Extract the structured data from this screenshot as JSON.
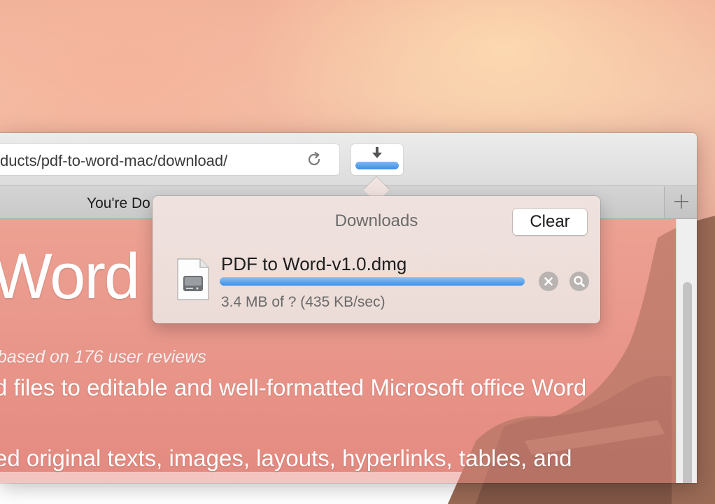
{
  "browser": {
    "address_bar": {
      "url": "ducts/pdf-to-word-mac/download/"
    },
    "reload_icon": "reload-icon",
    "downloads_icon": "download-arrow-icon",
    "tab": {
      "title": "You're Do"
    },
    "new_tab_icon": "plus-icon"
  },
  "page": {
    "headline": "Word",
    "rating": "based on 176 user reviews",
    "description": [
      "d files to editable and well-formatted Microsoft office Word",
      "ed original texts, images, layouts, hyperlinks, tables, and"
    ]
  },
  "downloads_popover": {
    "title": "Downloads",
    "clear_label": "Clear",
    "items": [
      {
        "file_name": "PDF to Word-v1.0.dmg",
        "status": "3.4 MB of ? (435 KB/sec)",
        "progress": 1.0,
        "file_icon": "disk-image-icon",
        "stop_icon": "stop-icon",
        "reveal_icon": "magnifier-icon"
      }
    ]
  },
  "colors": {
    "progress_blue": "#3d8fe9",
    "popover_bg": "#efe2de",
    "toolbar_bg": "#dcdcdc"
  }
}
